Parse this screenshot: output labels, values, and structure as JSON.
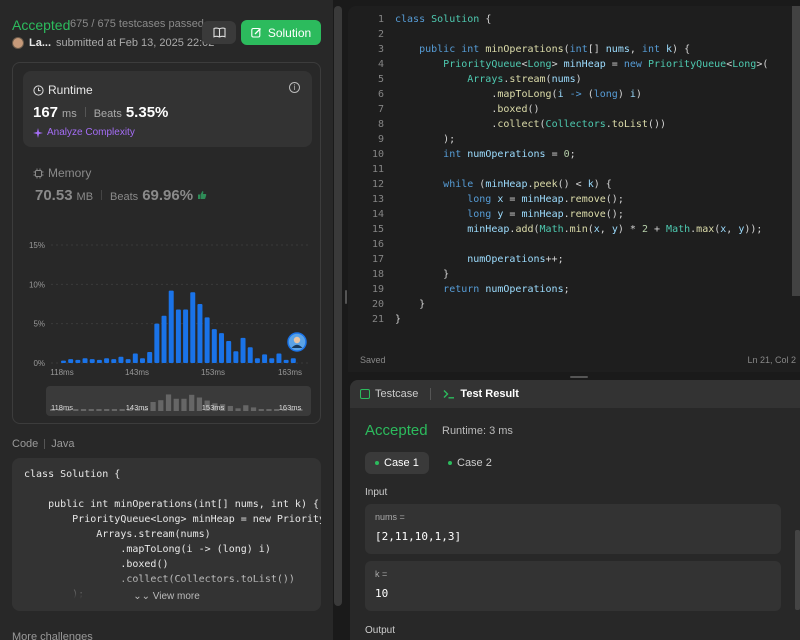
{
  "submission": {
    "status": "Accepted",
    "testcases": "675 / 675 testcases passed",
    "user": "La...",
    "submitted_text": "submitted at Feb 13, 2025 22:02",
    "solution_button": "Solution"
  },
  "runtime": {
    "label": "Runtime",
    "value": "167",
    "unit": "ms",
    "beats_label": "Beats",
    "beats_value": "5.35%",
    "analyze": "Analyze Complexity"
  },
  "memory": {
    "label": "Memory",
    "value": "70.53",
    "unit": "MB",
    "beats_label": "Beats",
    "beats_value": "69.96%"
  },
  "chart_data": {
    "type": "bar",
    "y_ticks": [
      "15%",
      "10%",
      "5%",
      "0%"
    ],
    "x_ticks": [
      "118ms",
      "143ms",
      "153ms",
      "163ms"
    ],
    "ylim": [
      0,
      15
    ],
    "highlight_color": "#1a73e8",
    "values": [
      0.3,
      0.5,
      0.4,
      0.6,
      0.5,
      0.4,
      0.6,
      0.5,
      0.8,
      0.5,
      1.2,
      0.6,
      1.4,
      5.0,
      6.0,
      9.2,
      6.8,
      6.8,
      9.0,
      7.5,
      5.8,
      4.3,
      3.8,
      2.8,
      1.5,
      3.2,
      2.0,
      0.6,
      1.1,
      0.6,
      1.2,
      0.4,
      0.6
    ],
    "mini_ticks": [
      "118ms",
      "143ms",
      "153ms",
      "163ms"
    ]
  },
  "code_preview": {
    "header_code": "Code",
    "header_lang": "Java",
    "lines": [
      "class Solution {",
      "",
      "    public int minOperations(int[] nums, int k) {",
      "        PriorityQueue<Long> minHeap = new PriorityQueue<Long>(",
      "            Arrays.stream(nums)",
      "                .mapToLong(i -> (long) i)",
      "                .boxed()",
      "                .collect(Collectors.toList())",
      "        );"
    ],
    "view_more": "View more",
    "more_challenges": "More challenges"
  },
  "editor": {
    "line_numbers": [
      "1",
      "2",
      "3",
      "4",
      "5",
      "6",
      "7",
      "8",
      "9",
      "10",
      "11",
      "12",
      "13",
      "14",
      "15",
      "16",
      "17",
      "18",
      "19",
      "20",
      "21"
    ],
    "status_left": "Saved",
    "status_right": "Ln 21, Col 2"
  },
  "test_panel": {
    "tab_testcase": "Testcase",
    "tab_result": "Test Result",
    "status": "Accepted",
    "runtime": "Runtime: 3 ms",
    "case1": "Case 1",
    "case2": "Case 2",
    "input_label": "Input",
    "nums_label": "nums =",
    "nums_value": "[2,11,10,1,3]",
    "k_label": "k =",
    "k_value": "10",
    "output_label": "Output"
  },
  "colors": {
    "accepted": "#2cbb5d",
    "analyze": "#a46df5"
  }
}
